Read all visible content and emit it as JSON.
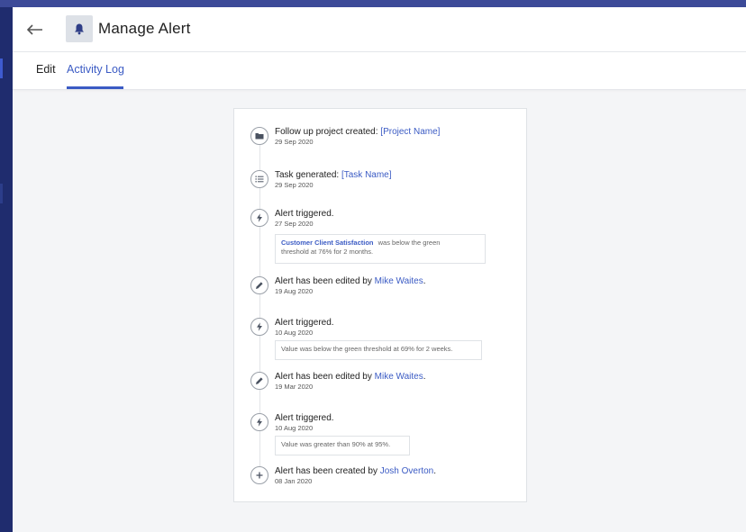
{
  "header": {
    "back_icon": "back-arrow-icon",
    "bell_icon": "bell-icon",
    "title": "Manage Alert"
  },
  "tabs": [
    {
      "label": "Edit",
      "active": false
    },
    {
      "label": "Activity Log",
      "active": true
    }
  ],
  "colors": {
    "accent": "#3b5bc4",
    "top_bar": "#3c4a98",
    "left_nav": "#1f2c6e"
  },
  "activity": [
    {
      "icon": "folder-icon",
      "text": "Follow up project created:",
      "link": "[Project Name]",
      "suffix": "",
      "date": "29 Sep 2020"
    },
    {
      "icon": "list-icon",
      "text": "Task generated:",
      "link": "[Task Name]",
      "suffix": "",
      "date": "29 Sep 2020"
    },
    {
      "icon": "lightning-icon",
      "text": "Alert triggered.",
      "date": "27 Sep 2020",
      "note_link": "Customer Client Satisfaction",
      "note_line1": "was below the green",
      "note_line2": "threshold at 76% for 2 months."
    },
    {
      "icon": "pencil-icon",
      "text": "Alert has been edited by",
      "link": "Mike Waites",
      "suffix": ".",
      "date": "19 Aug 2020"
    },
    {
      "icon": "lightning-icon",
      "text": "Alert triggered.",
      "date": "10 Aug 2020",
      "note": "Value was below the green threshold at 69% for 2 weeks."
    },
    {
      "icon": "pencil-icon",
      "text": "Alert has been edited by",
      "link": "Mike Waites",
      "suffix": ".",
      "date": "19 Mar 2020"
    },
    {
      "icon": "lightning-icon",
      "text": "Alert triggered.",
      "date": "10 Aug 2020",
      "note": "Value was greater than 90% at 95%."
    },
    {
      "icon": "plus-icon",
      "text": "Alert has been created by",
      "link": "Josh Overton",
      "suffix": ".",
      "date": "08 Jan 2020"
    }
  ]
}
